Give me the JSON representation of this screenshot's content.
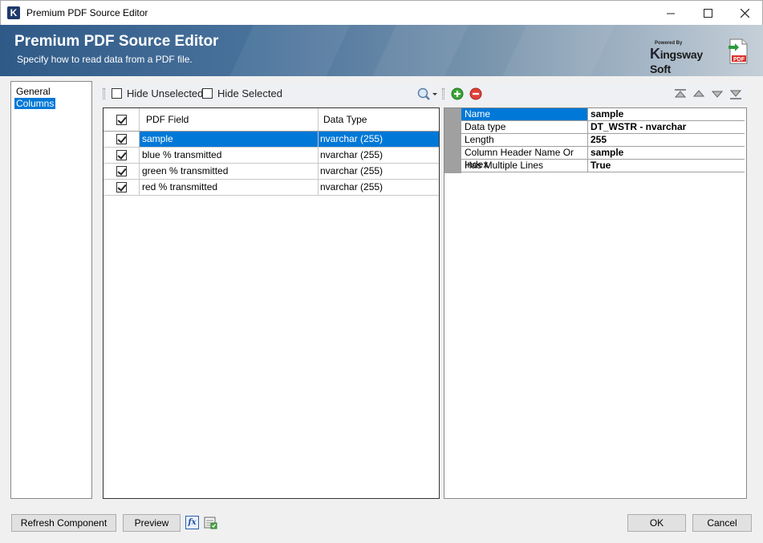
{
  "window": {
    "title": "Premium PDF Source Editor",
    "app_icon": "K",
    "controls": [
      "minimize-icon",
      "maximize-icon",
      "close-icon"
    ]
  },
  "banner": {
    "title": "Premium PDF Source Editor",
    "subtitle": "Specify how to read data from a PDF file.",
    "logo_powered": "Powered By",
    "logo_k": "K",
    "logo_name": "ingsway Soft",
    "pdf_badge": "PDF",
    "accent": "#2f5a87"
  },
  "nav": {
    "items": [
      {
        "label": "General",
        "selected": false
      },
      {
        "label": "Columns",
        "selected": true
      }
    ]
  },
  "column_toolbar": {
    "hide_unselected": {
      "label": "Hide Unselected",
      "checked": false
    },
    "hide_selected": {
      "label": "Hide Selected",
      "checked": false
    },
    "search_icon": "search-icon"
  },
  "columns_grid": {
    "headers": {
      "select_all_checked": true,
      "field": "PDF Field",
      "type": "Data Type"
    },
    "rows": [
      {
        "checked": true,
        "field": "sample",
        "type": "nvarchar (255)",
        "selected": true
      },
      {
        "checked": true,
        "field": "blue % transmitted",
        "type": "nvarchar (255)",
        "selected": false
      },
      {
        "checked": true,
        "field": "green % transmitted",
        "type": "nvarchar (255)",
        "selected": false
      },
      {
        "checked": true,
        "field": "red % transmitted",
        "type": "nvarchar (255)",
        "selected": false
      }
    ]
  },
  "properties_toolbar": {
    "icons": [
      "add-icon",
      "remove-icon",
      "move-top-icon",
      "move-up-icon",
      "move-down-icon",
      "move-bottom-icon"
    ]
  },
  "properties": [
    {
      "name": "Name",
      "value": "sample",
      "selected": true
    },
    {
      "name": "Data type",
      "value": "DT_WSTR - nvarchar",
      "selected": false
    },
    {
      "name": "Length",
      "value": "255",
      "selected": false
    },
    {
      "name": "Column Header Name Or Index",
      "value": "sample",
      "selected": false
    },
    {
      "name": "Has Multiple Lines",
      "value": "True",
      "selected": false
    }
  ],
  "footer": {
    "refresh_label": "Refresh Component",
    "preview_label": "Preview",
    "fx_label": "fx",
    "ok_label": "OK",
    "cancel_label": "Cancel"
  },
  "colors": {
    "selection": "#0078d7",
    "dialog_bg": "#f0f0f0"
  }
}
